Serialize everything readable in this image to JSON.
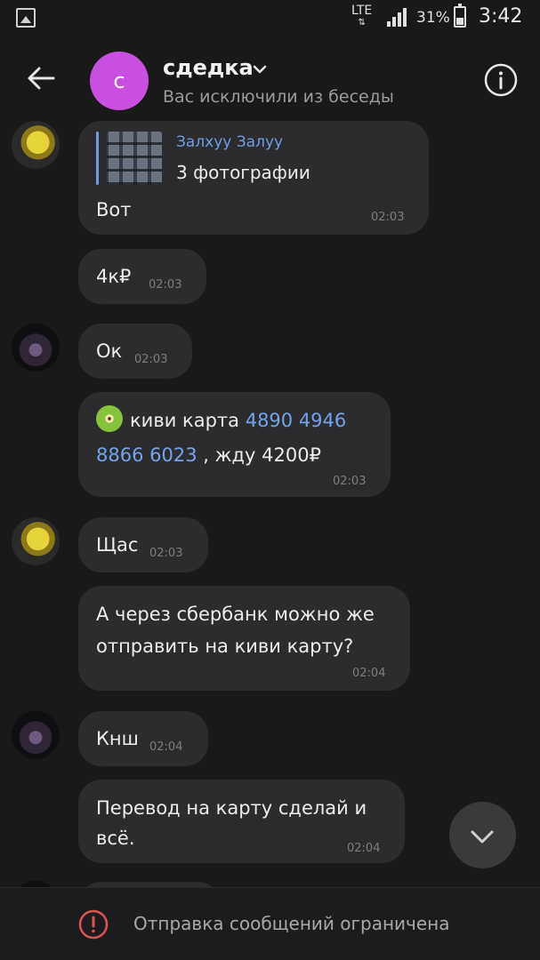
{
  "status_bar": {
    "network": "LTE",
    "battery_percent": "31%",
    "time": "3:42"
  },
  "header": {
    "avatar_letter": "с",
    "title": "сдедка",
    "subtitle": "Вас исключили из беседы",
    "avatar_color": "#c84fe0"
  },
  "messages": [
    {
      "reply": {
        "author": "Залхуу Залуу",
        "text": "3 фотографии"
      },
      "text": "Вот",
      "time": "02:03"
    },
    {
      "text": "4к₽",
      "time": "02:03"
    },
    {
      "text": "Ок",
      "time": "02:03"
    },
    {
      "line1_prefix": "киви  карта ",
      "line1_link": "4890 4946",
      "line2_link": "8866 6023",
      "line2_suffix": " , жду 4200₽",
      "time": "02:03"
    },
    {
      "text": "Щас",
      "time": "02:03"
    },
    {
      "line1": "А через сбербанк можно же",
      "line2": "отправить на киви карту?",
      "time": "02:04"
    },
    {
      "text": "Кнш",
      "time": "02:04"
    },
    {
      "line1": "Перевод на карту сделай и",
      "line2": "всё.",
      "time": "02:04"
    }
  ],
  "bottom_bar": {
    "text": "Отправка сообщений ограничена"
  },
  "colors": {
    "background": "#191919",
    "bubble": "#2c2c2e",
    "link": "#74a4e8",
    "warning": "#e05353"
  }
}
